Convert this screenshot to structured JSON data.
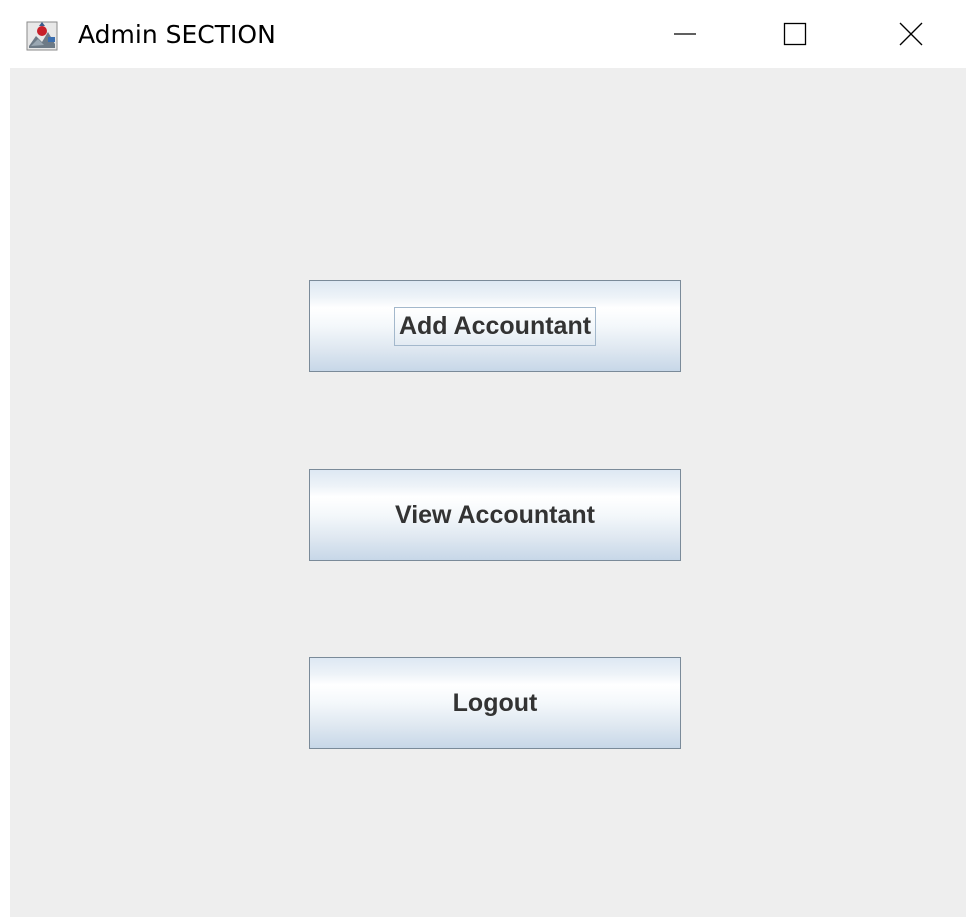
{
  "window": {
    "title": "Admin SECTION",
    "icon": "java-app-icon",
    "controls": {
      "minimize": "minimize-icon",
      "maximize": "maximize-icon",
      "close": "close-icon"
    }
  },
  "buttons": {
    "add_accountant": "Add Accountant",
    "view_accountant": "View Accountant",
    "logout": "Logout"
  },
  "colors": {
    "panel_background": "#eeeeee",
    "button_border": "#7a8a99",
    "button_text": "#333333",
    "focus_ring": "#a3b8cc"
  }
}
